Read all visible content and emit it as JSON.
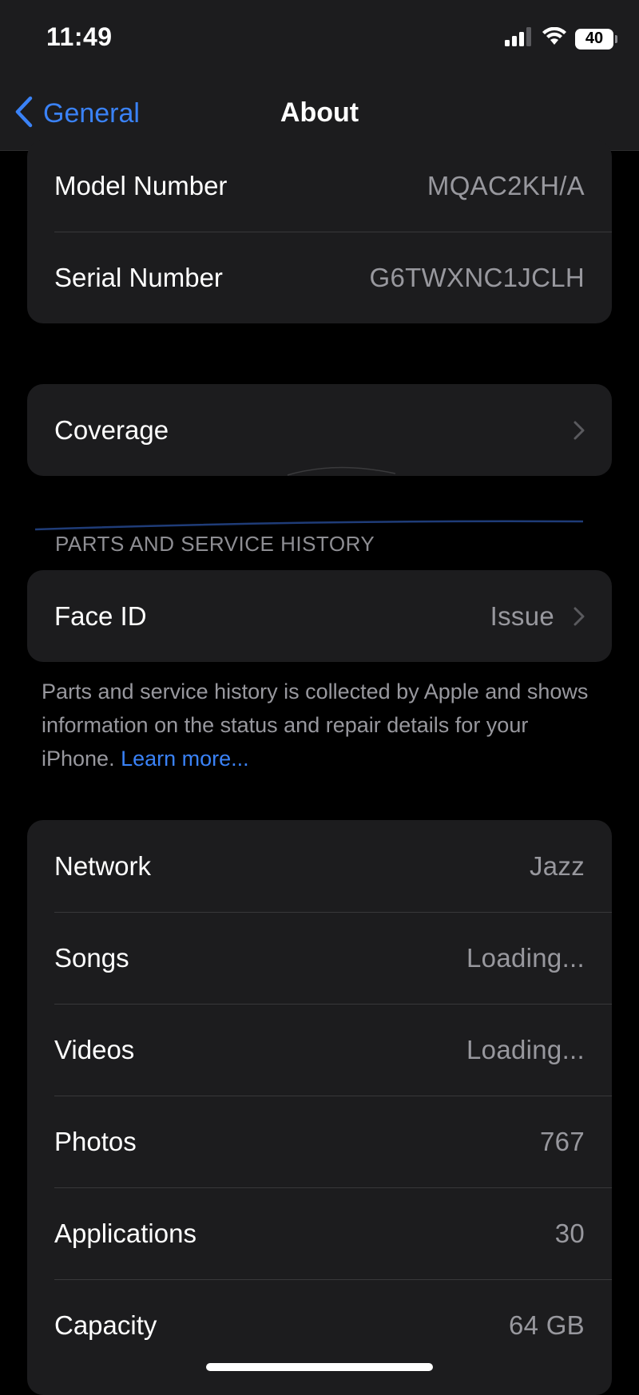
{
  "status_bar": {
    "time": "11:49",
    "battery": "40",
    "icons": [
      "cellular-signal-icon",
      "wifi-icon",
      "battery-icon"
    ]
  },
  "nav": {
    "back_label": "General",
    "title": "About"
  },
  "identity_rows": [
    {
      "label": "Model Number",
      "value": "MQAC2KH/A"
    },
    {
      "label": "Serial Number",
      "value": "G6TWXNC1JCLH"
    }
  ],
  "coverage": {
    "label": "Coverage"
  },
  "parts_service": {
    "header": "PARTS AND SERVICE HISTORY",
    "face_id_label": "Face ID",
    "face_id_value": "Issue",
    "footnote": "Parts and service history is collected by Apple and shows information on the status and repair details for your iPhone.",
    "learn_more": "Learn more..."
  },
  "info_rows": [
    {
      "label": "Network",
      "value": "Jazz"
    },
    {
      "label": "Songs",
      "value": "Loading..."
    },
    {
      "label": "Videos",
      "value": "Loading..."
    },
    {
      "label": "Photos",
      "value": "767"
    },
    {
      "label": "Applications",
      "value": "30"
    },
    {
      "label": "Capacity",
      "value": "64 GB"
    }
  ],
  "colors": {
    "accent": "#3a82f7",
    "background": "#000000",
    "card": "#1c1c1e",
    "secondary_text": "#98989e",
    "separator": "#38383a"
  }
}
